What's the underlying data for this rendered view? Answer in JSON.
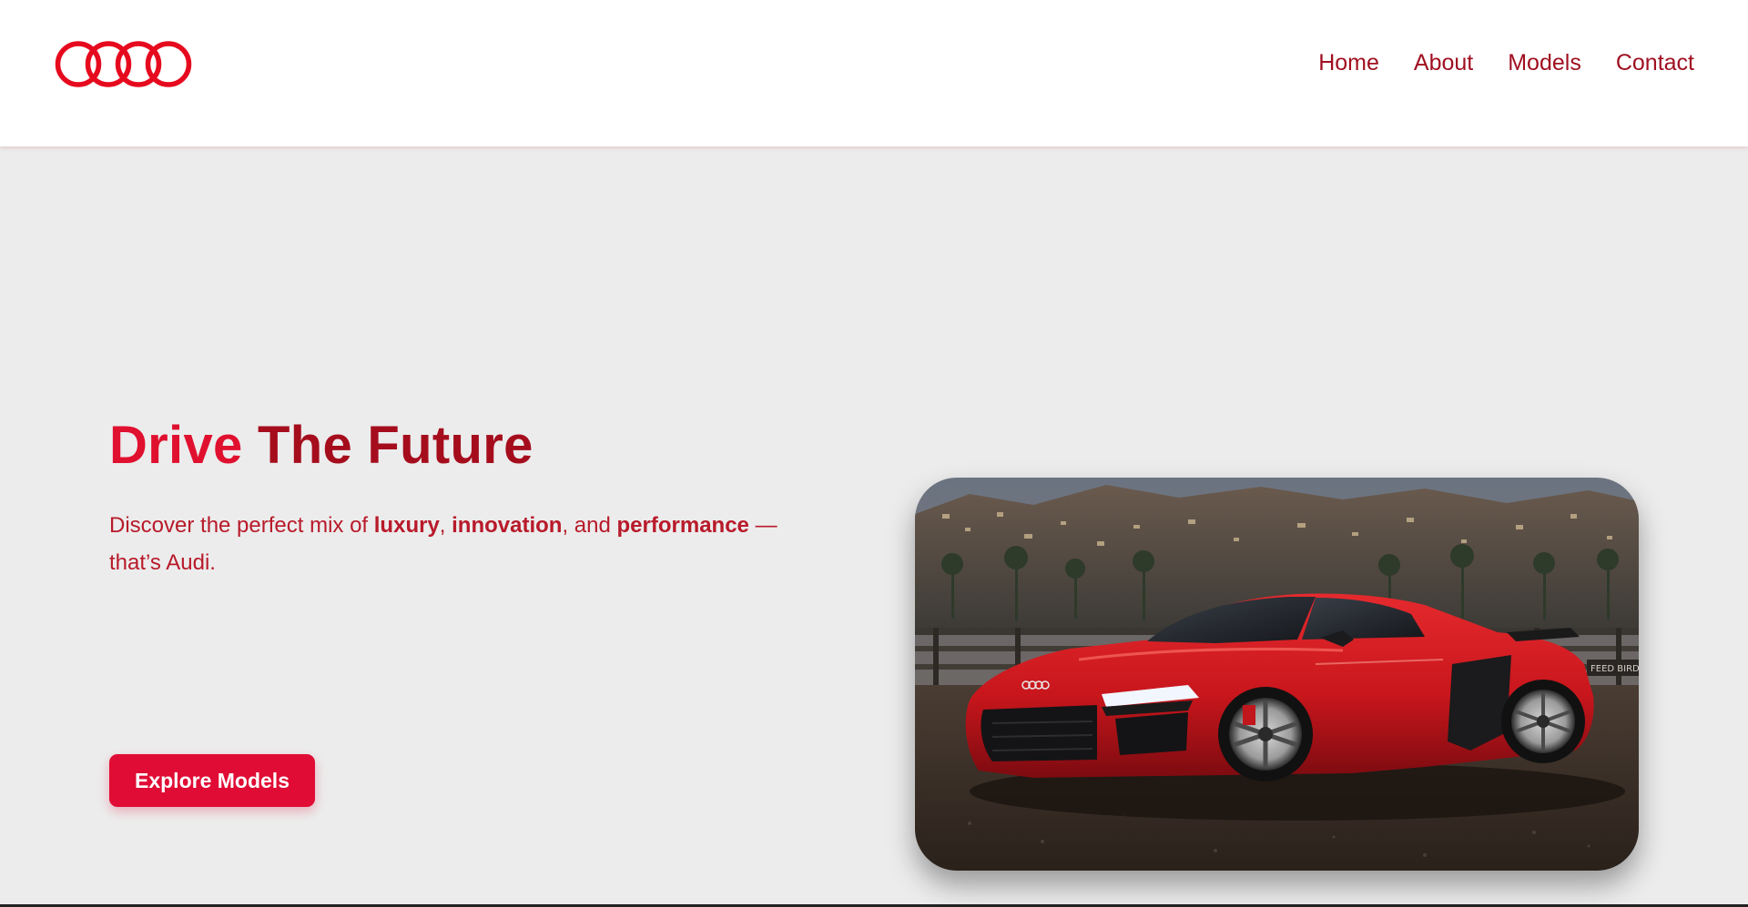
{
  "brand": {
    "logo_icon": "four-rings-logo",
    "color": "#e60a1e"
  },
  "nav": {
    "items": [
      {
        "label": "Home"
      },
      {
        "label": "About"
      },
      {
        "label": "Models"
      },
      {
        "label": "Contact"
      }
    ],
    "color": "#a01021"
  },
  "hero": {
    "title_word1": "Drive",
    "title_rest": " The Future",
    "desc_1": "Discover the perfect mix of ",
    "desc_b1": "luxury",
    "desc_2": ", ",
    "desc_b2": "innovation",
    "desc_3": ", and ",
    "desc_b3": "performance",
    "desc_4": " — that’s Audi.",
    "cta_label": "Explore Models",
    "image_alt": "Red Audi R8 parked by a seaside pier with hills in the background",
    "image_sign": "FEED BIRDS",
    "accent": "#e00c35"
  }
}
